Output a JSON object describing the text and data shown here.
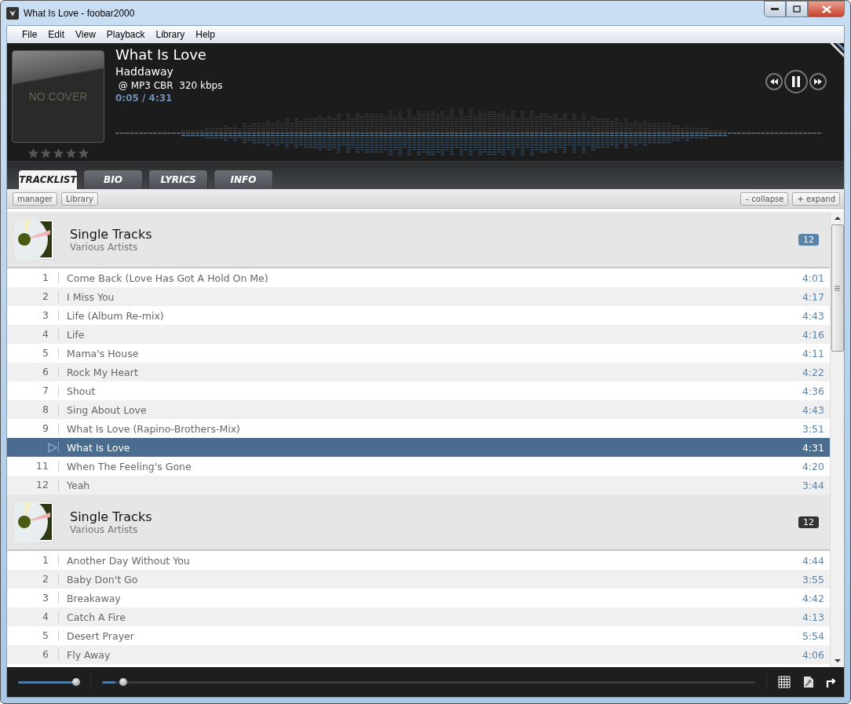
{
  "window": {
    "title": "What Is Love - foobar2000"
  },
  "menu": [
    "File",
    "Edit",
    "View",
    "Playback",
    "Library",
    "Help"
  ],
  "now_playing": {
    "cover_text": "NO COVER",
    "stars": 0,
    "title": "What Is Love",
    "artist": "Haddaway",
    "format": " @ MP3 CBR  320 kbps",
    "time": "0:05 / 4:31"
  },
  "tabs": [
    {
      "label": "TRACKLIST",
      "selected": true
    },
    {
      "label": "BIO",
      "selected": false
    },
    {
      "label": "LYRICS",
      "selected": false
    },
    {
      "label": "INFO",
      "selected": false
    }
  ],
  "toolbar": {
    "left": [
      "manager",
      "Library"
    ],
    "right": [
      "– collapse",
      "+ expand"
    ]
  },
  "groups": [
    {
      "title": "Single Tracks",
      "artist": "Various Artists",
      "count": "12",
      "active": true,
      "tracks": [
        {
          "number": "1",
          "title": "Come Back (Love Has Got A Hold On Me)",
          "duration": "4:01",
          "playing": false
        },
        {
          "number": "2",
          "title": "I Miss You",
          "duration": "4:17",
          "playing": false
        },
        {
          "number": "3",
          "title": "Life (Album Re-mix)",
          "duration": "4:43",
          "playing": false
        },
        {
          "number": "4",
          "title": "Life",
          "duration": "4:16",
          "playing": false
        },
        {
          "number": "5",
          "title": "Mama's House",
          "duration": "4:11",
          "playing": false
        },
        {
          "number": "6",
          "title": "Rock My Heart",
          "duration": "4:22",
          "playing": false
        },
        {
          "number": "7",
          "title": "Shout",
          "duration": "4:36",
          "playing": false
        },
        {
          "number": "8",
          "title": "Sing About Love",
          "duration": "4:43",
          "playing": false
        },
        {
          "number": "9",
          "title": "What Is Love (Rapino-Brothers-Mix)",
          "duration": "3:51",
          "playing": false
        },
        {
          "title": "What Is Love",
          "duration": "4:31",
          "playing": true
        },
        {
          "number": "11",
          "title": "When The Feeling's Gone",
          "duration": "4:20",
          "playing": false
        },
        {
          "number": "12",
          "title": "Yeah",
          "duration": "3:44",
          "playing": false
        }
      ]
    },
    {
      "title": "Single Tracks",
      "artist": "Various Artists",
      "count": "12",
      "active": false,
      "tracks": [
        {
          "number": "1",
          "title": "Another Day Without You",
          "duration": "4:44",
          "playing": false
        },
        {
          "number": "2",
          "title": "Baby Don't Go",
          "duration": "3:55",
          "playing": false
        },
        {
          "number": "3",
          "title": "Breakaway",
          "duration": "4:42",
          "playing": false
        },
        {
          "number": "4",
          "title": "Catch A Fire",
          "duration": "4:13",
          "playing": false
        },
        {
          "number": "5",
          "title": "Desert Prayer",
          "duration": "5:54",
          "playing": false
        },
        {
          "number": "6",
          "title": "Fly Away",
          "duration": "4:06",
          "playing": false
        }
      ]
    }
  ],
  "volume": {
    "level": 0.95
  },
  "seek": {
    "level": 0.02
  }
}
